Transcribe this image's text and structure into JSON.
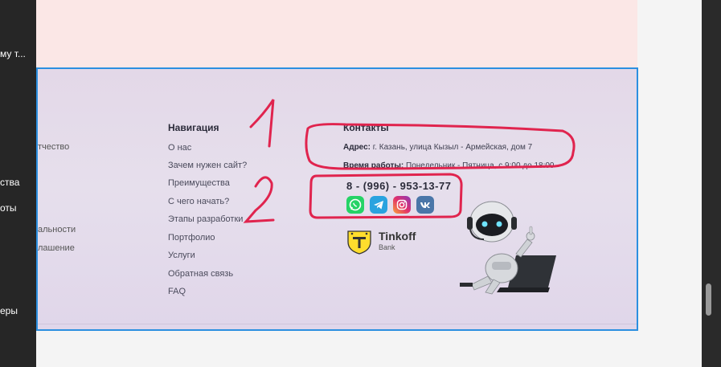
{
  "left_panel": {
    "items": [
      {
        "label": "му т..."
      },
      {
        "label": "ства"
      },
      {
        "label": "оты"
      },
      {
        "label": "еры"
      }
    ]
  },
  "footer_left": {
    "items": [
      {
        "label": "тчество"
      },
      {
        "label": "альности"
      },
      {
        "label": "лашение"
      }
    ]
  },
  "navigation": {
    "title": "Навигация",
    "items": [
      {
        "label": "О нас"
      },
      {
        "label": "Зачем нужен сайт?"
      },
      {
        "label": "Преимущества"
      },
      {
        "label": "С чего начать?"
      },
      {
        "label": "Этапы разработки"
      },
      {
        "label": "Портфолио"
      },
      {
        "label": "Услуги"
      },
      {
        "label": "Обратная связь"
      },
      {
        "label": "FAQ"
      }
    ]
  },
  "contacts": {
    "title": "Контакты",
    "address_label": "Адрес:",
    "address_value": "г. Казань, улица Кызыл - Армейская, дом 7",
    "hours_label": "Время работы:",
    "hours_value": "Понедельник - Пятница, с 9:00 до 18:00",
    "phone": "8 - (996) - 953-13-77",
    "socials": [
      {
        "icon": "whatsapp-icon",
        "color": "#25d366"
      },
      {
        "icon": "telegram-icon",
        "color": "#2aa3df"
      },
      {
        "icon": "instagram-icon",
        "color": "#e1306c"
      },
      {
        "icon": "vk-icon",
        "color": "#4a76a8"
      }
    ]
  },
  "tinkoff": {
    "brand": "Tinkoff",
    "sub": "Bank"
  },
  "annotations": {
    "label_1": "1",
    "label_2": "2",
    "color": "#e0244e"
  }
}
